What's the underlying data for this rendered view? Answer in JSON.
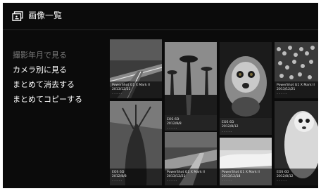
{
  "header": {
    "title": "画像一覧",
    "icon": "photo-album-icon"
  },
  "menu": {
    "items": [
      {
        "label": "撮影年月で見る",
        "dim": true
      },
      {
        "label": "カメラ別に見る",
        "dim": false
      },
      {
        "label": "まとめて消去する",
        "dim": false
      },
      {
        "label": "まとめてコピーする",
        "dim": false
      }
    ]
  },
  "photos": [
    {
      "subject": "highway-night",
      "camera": "PowerShot G1 X Mark II",
      "date": "2013/12/21"
    },
    {
      "subject": "baobab-avenue",
      "camera": "",
      "date": ""
    },
    {
      "subject": "lemur",
      "camera": "",
      "date": ""
    },
    {
      "subject": "shells-market",
      "camera": "PowerShot G1 X Mark II",
      "date": "2013/12/21"
    },
    {
      "subject": "baobab-trunk",
      "camera": "EOS 6D",
      "date": "2012/8/8"
    },
    {
      "subject": "baobab-reflection",
      "camera": "EOS 6D",
      "date": "2012/8/8"
    },
    {
      "subject": "lemur-closeup",
      "camera": "EOS 6D",
      "date": "2012/8/12"
    },
    {
      "subject": "river-road",
      "camera": "PowerShot G1 X Mark II",
      "date": "2013/12/21"
    },
    {
      "subject": "white-desert",
      "camera": "PowerShot G1 X Mark II",
      "date": "2013/12/18"
    },
    {
      "subject": "lemur-side",
      "camera": "EOS 6D",
      "date": "2012/8/12"
    }
  ]
}
